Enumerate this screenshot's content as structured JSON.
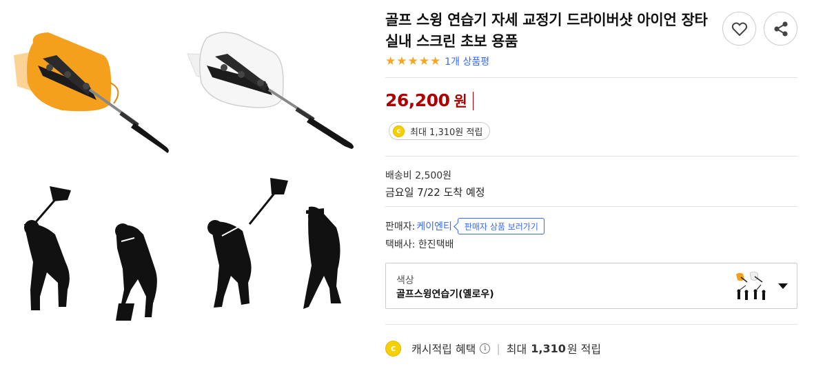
{
  "product": {
    "title": "골프 스윙 연습기 자세 교정기 드라이버샷 아이언 장타 실내 스크린 초보 용품",
    "review_count_label": "1개 상품평",
    "rating_stars": 5
  },
  "price": {
    "amount": "26,200",
    "unit": "원"
  },
  "reward_chip": {
    "coin_letter": "c",
    "text": "최대 1,310원 적립"
  },
  "shipping": {
    "fee": "배송비 2,500원",
    "arrival": "금요일 7/22 도착 예정"
  },
  "seller": {
    "label": "판매자: ",
    "name": "케이엔티",
    "store_button": "판매자 상품 보러가기"
  },
  "courier": "택배사: 한진택배",
  "option": {
    "label": "색상",
    "selected": "골프스윙연습기(옐로우)"
  },
  "cash": {
    "coin_letter": "c",
    "label": "캐시적립 혜택",
    "info_glyph": "i",
    "separator": "|",
    "prefix": "최대",
    "amount": "1,310",
    "suffix": "원 적립"
  },
  "colors": {
    "price_red": "#ae0000",
    "link_blue": "#346aff",
    "star_gold": "#f5a623",
    "coin_yellow": "#f7d000",
    "paddle_orange": "#f5a01c"
  },
  "icons": [
    "heart-icon",
    "share-icon",
    "star-icon",
    "coin-icon",
    "info-icon",
    "caret-down-icon"
  ]
}
